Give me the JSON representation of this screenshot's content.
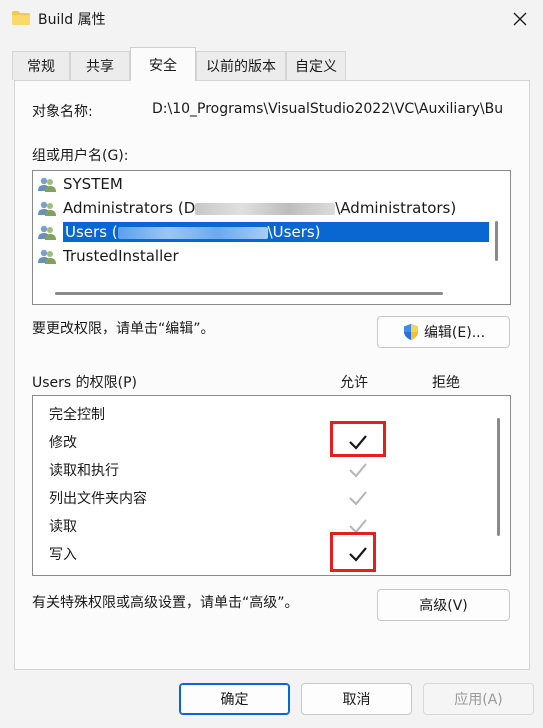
{
  "window": {
    "title": "Build 属性"
  },
  "tabs": [
    {
      "label": "常规",
      "active": false
    },
    {
      "label": "共享",
      "active": false
    },
    {
      "label": "安全",
      "active": true
    },
    {
      "label": "以前的版本",
      "active": false
    },
    {
      "label": "自定义",
      "active": false
    }
  ],
  "object": {
    "label": "对象名称:",
    "value": "D:\\10_Programs\\VisualStudio2022\\VC\\Auxiliary\\Bu"
  },
  "groups": {
    "label": "组或用户名(G):",
    "items": [
      {
        "name": "SYSTEM",
        "suffix": "",
        "selected": false
      },
      {
        "name": "Administrators (D",
        "suffix": "\\Administrators)",
        "selected": false
      },
      {
        "name": "Users (",
        "suffix": "\\Users)",
        "selected": true
      },
      {
        "name": "TrustedInstaller",
        "suffix": "",
        "selected": false
      }
    ]
  },
  "edit": {
    "hint": "要更改权限，请单击“编辑”。",
    "button_label": "编辑(E)..."
  },
  "permissions": {
    "label": "Users 的权限(P)",
    "allow_label": "允许",
    "deny_label": "拒绝",
    "items": [
      {
        "name": "完全控制",
        "allow": "none",
        "highlighted": false
      },
      {
        "name": "修改",
        "allow": "checked",
        "highlighted": true
      },
      {
        "name": "读取和执行",
        "allow": "inherited",
        "highlighted": false
      },
      {
        "name": "列出文件夹内容",
        "allow": "inherited",
        "highlighted": false
      },
      {
        "name": "读取",
        "allow": "inherited",
        "highlighted": false
      },
      {
        "name": "写入",
        "allow": "checked",
        "highlighted": true
      }
    ]
  },
  "advanced": {
    "hint": "有关特殊权限或高级设置，请单击“高级”。",
    "button_label": "高级(V)"
  },
  "footer": {
    "ok_label": "确定",
    "cancel_label": "取消",
    "apply_label": "应用(A)"
  },
  "colors": {
    "selection": "#0a67d2",
    "highlight_box": "#e3201b",
    "folder": "#f4c84a"
  }
}
